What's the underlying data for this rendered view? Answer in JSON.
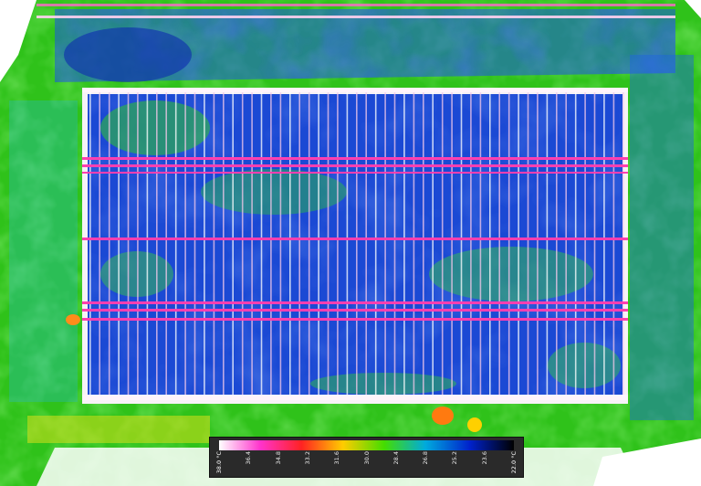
{
  "image": {
    "description_type": "aerial thermal orthomosaic",
    "palette": [
      "#ffffff",
      "#ff33cc",
      "#ff2222",
      "#ffcc00",
      "#44dd00",
      "#00aadd",
      "#0022cc",
      "#000000"
    ],
    "colors": {
      "panel_cool": "#1a3fd6",
      "grass_warm": "#3bd21a",
      "hot_frame": "#ff3fb0",
      "ground_mask": "#ffffff"
    }
  },
  "scale_bar": {
    "unit": "°C",
    "ticks": [
      "38.0 °C",
      "36.4",
      "34.8",
      "33.2",
      "31.6",
      "30.0",
      "28.4",
      "26.8",
      "25.2",
      "23.6",
      "22.0 °C"
    ]
  }
}
